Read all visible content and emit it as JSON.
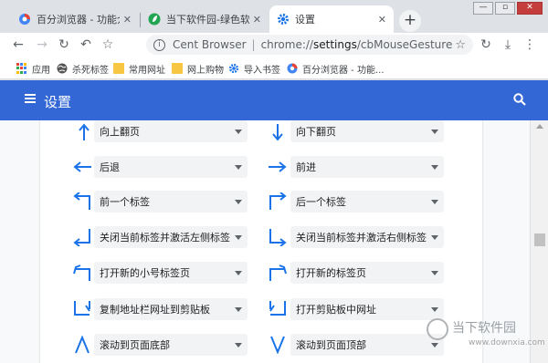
{
  "tabs": [
    {
      "title": "百分浏览器 - 功能介绍"
    },
    {
      "title": "当下软件园-绿色软件..."
    },
    {
      "title": "设置"
    }
  ],
  "toolbar": {
    "site": "Cent Browser",
    "separator": "|",
    "url_prefix": "chrome://",
    "url_host": "settings",
    "url_path": "/cbMouseGesture"
  },
  "bookmarks": [
    {
      "label": "应用"
    },
    {
      "label": "杀死标签"
    },
    {
      "label": "常用网址"
    },
    {
      "label": "网上购物"
    },
    {
      "label": "导入书签"
    },
    {
      "label": "百分浏览器 - 功能..."
    }
  ],
  "header": {
    "title": "设置"
  },
  "gestures": [
    {
      "left": "向上翻页",
      "right": "向下翻页",
      "left_icon": "arrow-up-icon",
      "right_icon": "arrow-down-icon"
    },
    {
      "left": "后退",
      "right": "前进",
      "left_icon": "arrow-left-icon",
      "right_icon": "arrow-right-icon"
    },
    {
      "left": "前一个标签",
      "right": "后一个标签",
      "left_icon": "arrow-left-up-icon",
      "right_icon": "arrow-right-up-icon"
    },
    {
      "left": "关闭当前标签并激活左侧标签",
      "right": "关闭当前标签并激活右侧标签",
      "left_icon": "arrow-down-left-icon",
      "right_icon": "arrow-down-right-icon"
    },
    {
      "left": "打开新的小号标签页",
      "right": "打开新的标签页",
      "left_icon": "arrow-up-left-icon",
      "right_icon": "arrow-up-right-icon"
    },
    {
      "left": "复制地址栏网址到剪贴板",
      "right": "打开剪贴板中网址",
      "left_icon": "arrow-down-left2-icon",
      "right_icon": "arrow-down-right2-icon"
    },
    {
      "left": "滚动到页面底部",
      "right": "滚动到页面顶部",
      "left_icon": "arrow-up-down-icon",
      "right_icon": "arrow-down-up-icon"
    }
  ],
  "watermark": {
    "name": "当下软件园",
    "domain": "www.downxia.com"
  },
  "colors": {
    "header": "#3367d6",
    "arrow": "#1a73e8"
  }
}
